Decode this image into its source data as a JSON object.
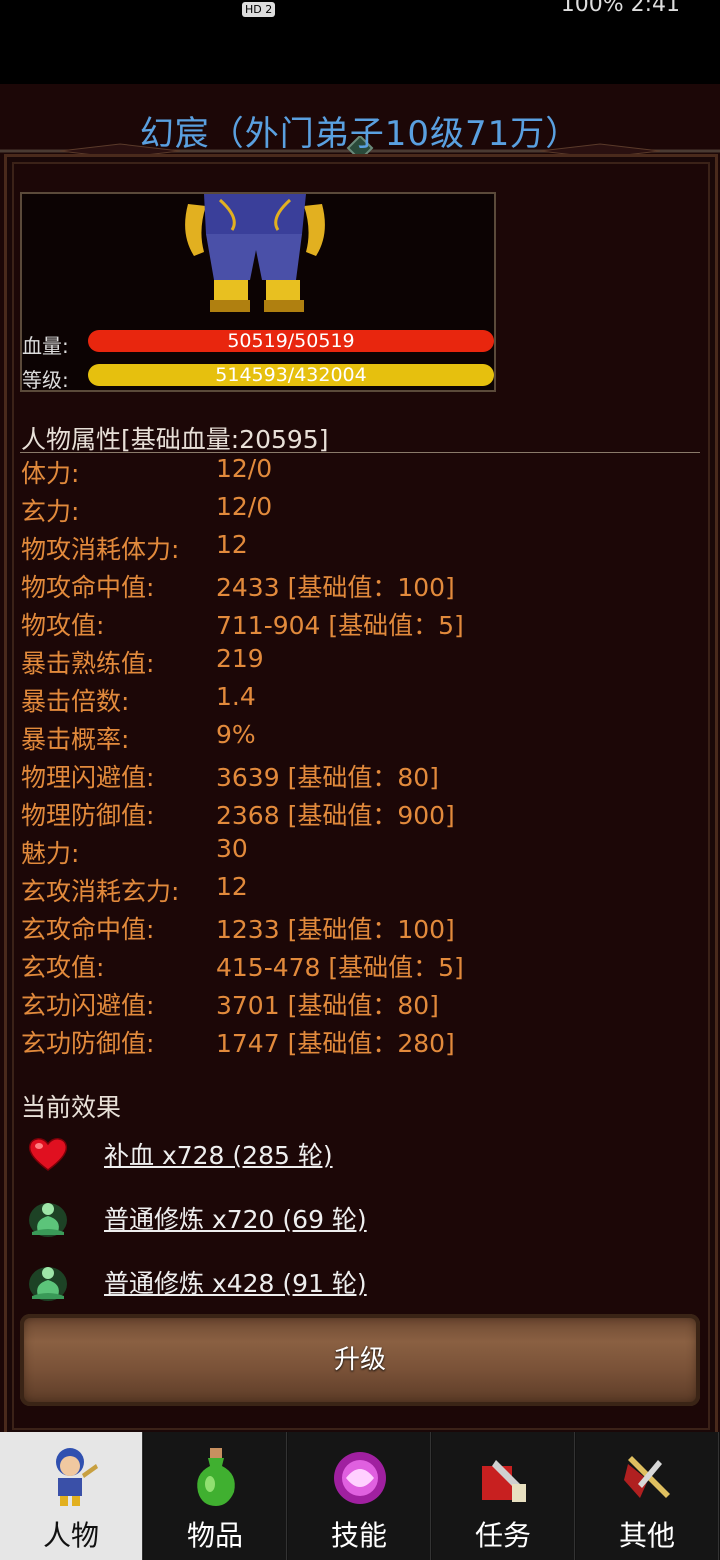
{
  "status": {
    "left": "HD 2",
    "right": "100% 2:41"
  },
  "title": "幻宸（外门弟子10级71万）",
  "portrait": {
    "hp_label": "血量:",
    "hp_value": "50519/50519",
    "hp_fraction": 1.0,
    "level_label": "等级:",
    "level_value": "514593/432004",
    "level_fraction": 1.0
  },
  "attributes": {
    "header": "人物属性[基础血量:20595]",
    "rows": [
      {
        "key": "体力:",
        "value": "12/0"
      },
      {
        "key": "玄力:",
        "value": "12/0"
      },
      {
        "key": "物攻消耗体力:",
        "value": "12"
      },
      {
        "key": "物攻命中值:",
        "value": "2433 [基础值：100]"
      },
      {
        "key": "物攻值:",
        "value": "711-904 [基础值：5]"
      },
      {
        "key": "暴击熟练值:",
        "value": "219"
      },
      {
        "key": "暴击倍数:",
        "value": "1.4"
      },
      {
        "key": "暴击概率:",
        "value": "9%"
      },
      {
        "key": "物理闪避值:",
        "value": "3639 [基础值：80]"
      },
      {
        "key": "物理防御值:",
        "value": "2368 [基础值：900]"
      },
      {
        "key": "魅力:",
        "value": "30"
      },
      {
        "key": "玄攻消耗玄力:",
        "value": "12"
      },
      {
        "key": "玄攻命中值:",
        "value": "1233 [基础值：100]"
      },
      {
        "key": "玄攻值:",
        "value": "415-478 [基础值：5]"
      },
      {
        "key": "玄功闪避值:",
        "value": "3701 [基础值：80]"
      },
      {
        "key": "玄功防御值:",
        "value": "1747 [基础值：280]"
      }
    ]
  },
  "effects": {
    "header": "当前效果",
    "items": [
      {
        "icon": "heart-icon",
        "text": "补血 x728 (285 轮)"
      },
      {
        "icon": "meditation-icon",
        "text": "普通修炼 x720 (69 轮)"
      },
      {
        "icon": "meditation-icon",
        "text": "普通修炼 x428 (91 轮)"
      }
    ]
  },
  "upgrade_button": "升级",
  "tabs": [
    {
      "label": "人物",
      "icon": "character-icon",
      "active": true
    },
    {
      "label": "物品",
      "icon": "potion-icon",
      "active": false
    },
    {
      "label": "技能",
      "icon": "skill-orb-icon",
      "active": false
    },
    {
      "label": "任务",
      "icon": "quest-icon",
      "active": false
    },
    {
      "label": "其他",
      "icon": "sword-shield-icon",
      "active": false
    }
  ],
  "colors": {
    "attribute_text": "#e28a3c",
    "title_text": "#5aa0e0",
    "hp_bar": "#e8260e",
    "level_bar": "#e6c00e",
    "panel_bg": "#1c0707"
  }
}
